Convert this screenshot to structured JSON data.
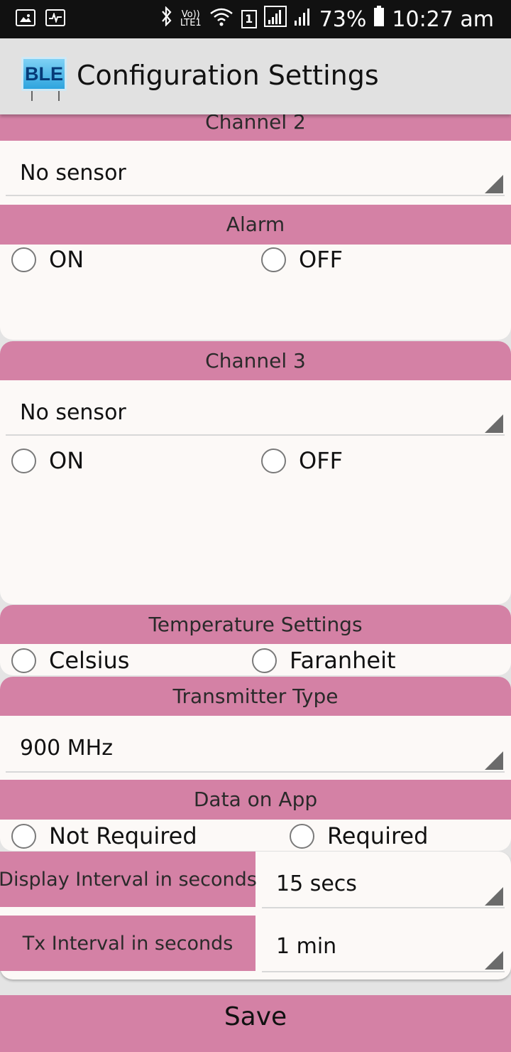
{
  "status_bar": {
    "icons": [
      "image-icon",
      "pulse-icon",
      "bluetooth-icon",
      "volte-icon",
      "wifi-icon",
      "sim1-icon",
      "signal-icon",
      "signal2-icon",
      "battery-icon"
    ],
    "volte_top": "Vo))",
    "volte_bottom": "LTE1",
    "sim_badge": "1",
    "battery": "73%",
    "time": "10:27 am"
  },
  "app_bar": {
    "logo_text": "BLE",
    "title": "Configuration Settings"
  },
  "channel2": {
    "header": "Channel 2",
    "sensor_value": "No sensor"
  },
  "alarm": {
    "header": "Alarm",
    "option_on": "ON",
    "option_off": "OFF"
  },
  "channel3": {
    "header": "Channel 3",
    "sensor_value": "No sensor",
    "option_on": "ON",
    "option_off": "OFF"
  },
  "temperature": {
    "header": "Temperature Settings",
    "option_celsius": "Celsius",
    "option_faranheit": "Faranheit"
  },
  "transmitter": {
    "header": "Transmitter Type",
    "value": "900 MHz"
  },
  "data_on_app": {
    "header": "Data on App",
    "option_not_required": "Not Required",
    "option_required": "Required"
  },
  "intervals": {
    "display_label": "Display Interval in seconds",
    "display_value": "15 secs",
    "tx_label": "Tx Interval in seconds",
    "tx_value": "1 min"
  },
  "save_label": "Save",
  "colors": {
    "section_header": "#d481a5",
    "card_background": "#fcf9f7",
    "status_bar": "#111111",
    "app_bar": "#e1e1e1"
  }
}
